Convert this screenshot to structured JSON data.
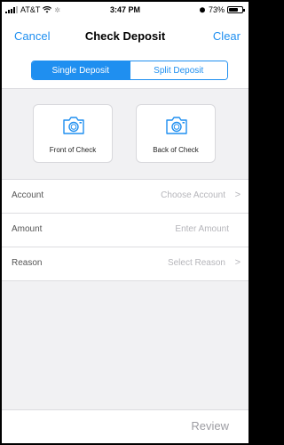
{
  "status_bar": {
    "carrier": "AT&T",
    "time": "3:47 PM",
    "battery": "73%",
    "battery_level": 0.73
  },
  "nav": {
    "cancel": "Cancel",
    "title": "Check Deposit",
    "clear": "Clear"
  },
  "segments": {
    "single": "Single Deposit",
    "split": "Split Deposit",
    "selected": "single"
  },
  "capture": {
    "front_label": "Front of Check",
    "back_label": "Back of Check"
  },
  "form": {
    "rows": [
      {
        "label": "Account",
        "value": "Choose Account",
        "chevron": true
      },
      {
        "label": "Amount",
        "value": "Enter Amount",
        "chevron": false
      },
      {
        "label": "Reason",
        "value": "Select Reason",
        "chevron": true
      }
    ]
  },
  "footer": {
    "review": "Review"
  },
  "colors": {
    "accent": "#1f8ff0",
    "background": "#f1f1f3",
    "placeholder": "#b5b5ba"
  }
}
